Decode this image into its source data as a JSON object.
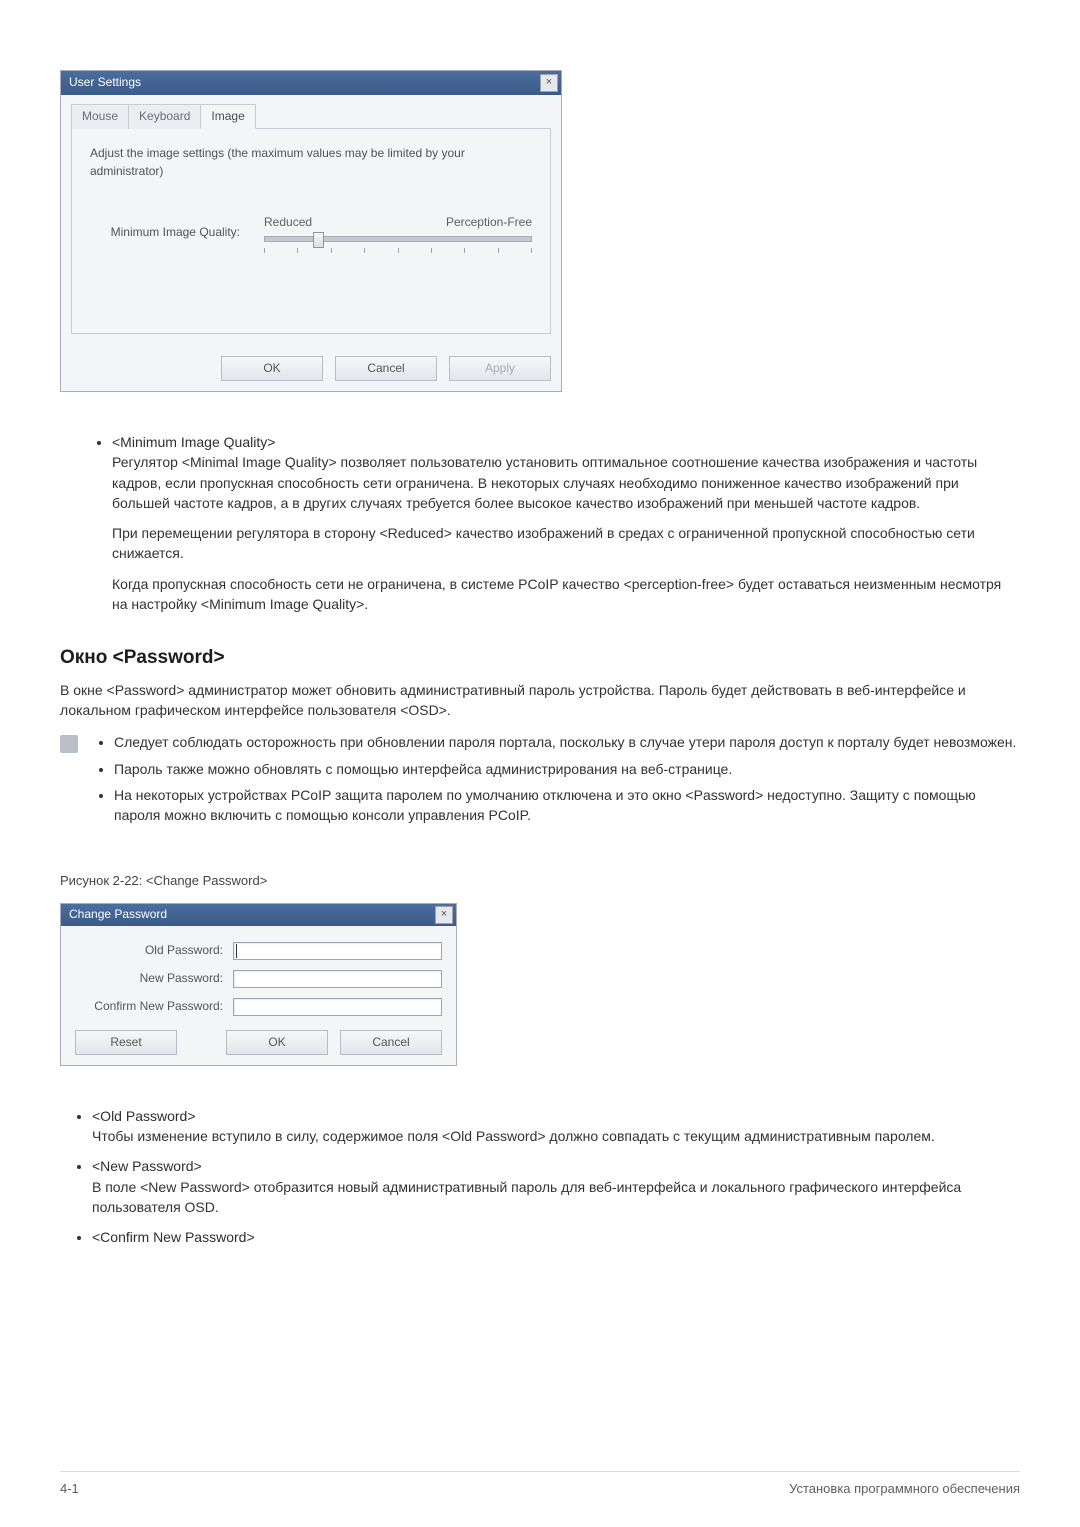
{
  "dialog1": {
    "title": "User Settings",
    "close": "×",
    "tabs": {
      "mouse": "Mouse",
      "keyboard": "Keyboard",
      "image": "Image"
    },
    "note": "Adjust the image settings (the maximum values may be limited by your administrator)",
    "slider_label": "Minimum Image Quality:",
    "slider_left": "Reduced",
    "slider_right": "Perception-Free",
    "buttons": {
      "ok": "OK",
      "cancel": "Cancel",
      "apply": "Apply"
    }
  },
  "miq": {
    "term": "<Minimum Image Quality>",
    "p1": "Регулятор <Minimal Image Quality> позволяет пользователю установить оптимальное соотношение качества изображения и частоты кадров, если пропускная способность сети ограничена. В некоторых случаях необходимо пониженное качество изображений при большей частоте кадров, а в других случаях требуется более высокое качество изображений при меньшей частоте кадров.",
    "p2": "При перемещении регулятора в сторону <Reduced> качество изображений в средах с ограниченной пропускной способностью сети снижается.",
    "p3": "Когда пропускная способность сети не ограничена, в системе PCoIP качество <perception-free> будет оставаться неизменным несмотря на настройку <Minimum Image Quality>."
  },
  "pw_section": {
    "heading": "Окно <Password>",
    "intro": "В окне <Password> администратор может обновить административный пароль устройства. Пароль будет действовать в веб-интерфейсе и локальном графическом интерфейсе пользователя <OSD>.",
    "notes": {
      "n1": "Следует соблюдать осторожность при обновлении пароля портала, поскольку в случае утери пароля доступ к порталу будет невозможен.",
      "n2": "Пароль также можно обновлять с помощью интерфейса администрирования на веб-странице.",
      "n3": "На некоторых устройствах PCoIP защита паролем по умолчанию отключена и это окно <Password> недоступно. Защиту с помощью пароля можно включить с помощью консоли управления PCoIP."
    }
  },
  "fig_caption": "Рисунок 2-22: <Change Password>",
  "dialog2": {
    "title": "Change Password",
    "close": "×",
    "labels": {
      "old": "Old Password:",
      "new": "New Password:",
      "confirm": "Confirm New Password:"
    },
    "buttons": {
      "reset": "Reset",
      "ok": "OK",
      "cancel": "Cancel"
    }
  },
  "fields": {
    "old_term": "<Old Password>",
    "old_text": "Чтобы изменение вступило в силу, содержимое поля <Old Password> должно совпадать с текущим административным паролем.",
    "new_term": "<New Password>",
    "new_text": "В поле <New Password> отобразится новый административный пароль для веб-интерфейса и локального графического интерфейса пользователя OSD.",
    "confirm_term": "<Confirm New Password>"
  },
  "footer": {
    "left": "4-1",
    "right": "Установка программного обеспечения"
  }
}
